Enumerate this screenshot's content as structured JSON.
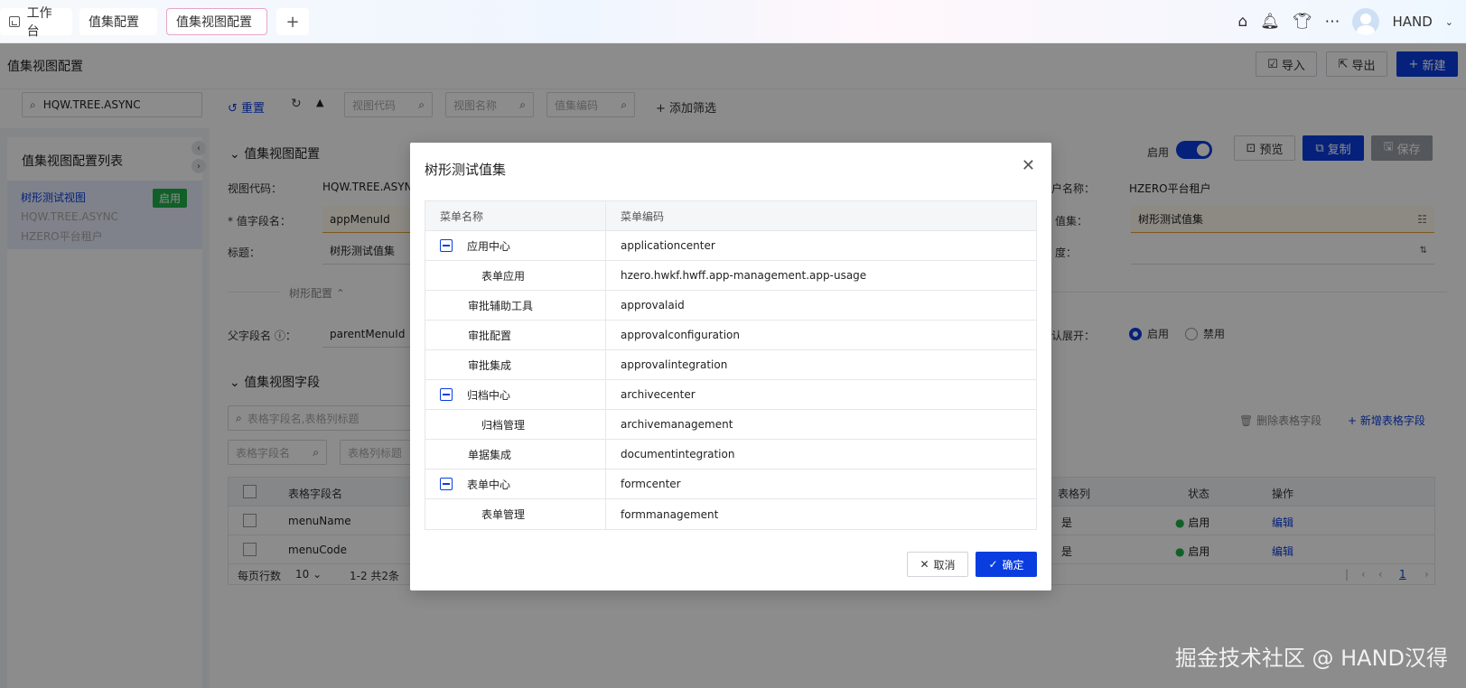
{
  "topbar": {
    "tabs": [
      {
        "label": "工作台"
      },
      {
        "label": "值集配置"
      },
      {
        "label": "值集视图配置"
      },
      {
        "label": "+"
      }
    ],
    "username": "HAND"
  },
  "page": {
    "title": "值集视图配置",
    "import_label": "导入",
    "export_label": "导出",
    "new_label": "新建"
  },
  "filter": {
    "search_value": "HQW.TREE.ASYNC",
    "reset_label": "重置",
    "view_code_placeholder": "视图代码",
    "view_name_placeholder": "视图名称",
    "valueset_code_placeholder": "值集编码",
    "add_filter_label": "添加筛选"
  },
  "left": {
    "title": "值集视图配置列表",
    "item": {
      "name": "树形测试视图",
      "code": "HQW.TREE.ASYNC",
      "tenant": "HZERO平台租户",
      "status": "启用"
    }
  },
  "main": {
    "section_config": "值集视图配置",
    "enabled_label": "启用",
    "preview_label": "预览",
    "copy_label": "复制",
    "save_label": "保存",
    "view_code_label": "视图代码：",
    "view_code_value": "HQW.TREE.ASYNC",
    "tenant_label": "户名称：",
    "tenant_value": "HZERO平台租户",
    "value_field_label": "* 值字段名：",
    "value_field_value": "appMenuId",
    "valueset_label": "值集：",
    "valueset_value": "树形测试值集",
    "title_label": "标题：",
    "title_value": "树形测试值集",
    "width_label": "度：",
    "tree_config": "树形配置",
    "parent_field_label": "父字段名 ⓘ：",
    "parent_field_value": "parentMenuId",
    "expand_label": "认展开：",
    "expand_on": "启用",
    "expand_off": "禁用",
    "section_fields": "值集视图字段",
    "field_search_placeholder": "表格字段名,表格列标题",
    "field_name_placeholder": "表格字段名",
    "column_title_placeholder": "表格列标题",
    "delete_field_label": "删除表格字段",
    "add_field_label": "新增表格字段",
    "table_headers": {
      "field": "表格字段名",
      "column": "表格列",
      "status": "状态",
      "action": "操作"
    },
    "rows": [
      {
        "field": "menuName",
        "column": "是",
        "status": "启用",
        "action": "编辑"
      },
      {
        "field": "menuCode",
        "column": "是",
        "status": "启用",
        "action": "编辑"
      }
    ],
    "pager": {
      "per_page_label": "每页行数",
      "per_page": "10",
      "range": "1-2  共2条",
      "page": "1"
    }
  },
  "modal": {
    "title": "树形测试值集",
    "col_name": "菜单名称",
    "col_code": "菜单编码",
    "rows": [
      {
        "name": "应用中心",
        "code": "applicationcenter",
        "level": 0,
        "toggle": true
      },
      {
        "name": "表单应用",
        "code": "hzero.hwkf.hwff.app-management.app-usage",
        "level": 1,
        "toggle": false
      },
      {
        "name": "审批辅助工具",
        "code": "approvalaid",
        "level": 0.5,
        "toggle": false
      },
      {
        "name": "审批配置",
        "code": "approvalconfiguration",
        "level": 0.5,
        "toggle": false
      },
      {
        "name": "审批集成",
        "code": "approvalintegration",
        "level": 0.5,
        "toggle": false
      },
      {
        "name": "归档中心",
        "code": "archivecenter",
        "level": 0,
        "toggle": true
      },
      {
        "name": "归档管理",
        "code": "archivemanagement",
        "level": 1,
        "toggle": false
      },
      {
        "name": "单据集成",
        "code": "documentintegration",
        "level": 0.5,
        "toggle": false
      },
      {
        "name": "表单中心",
        "code": "formcenter",
        "level": 0,
        "toggle": true
      },
      {
        "name": "表单管理",
        "code": "formmanagement",
        "level": 1,
        "toggle": false
      }
    ],
    "cancel_label": "取消",
    "ok_label": "确定"
  },
  "watermark": "掘金技术社区 @ HAND汉得"
}
